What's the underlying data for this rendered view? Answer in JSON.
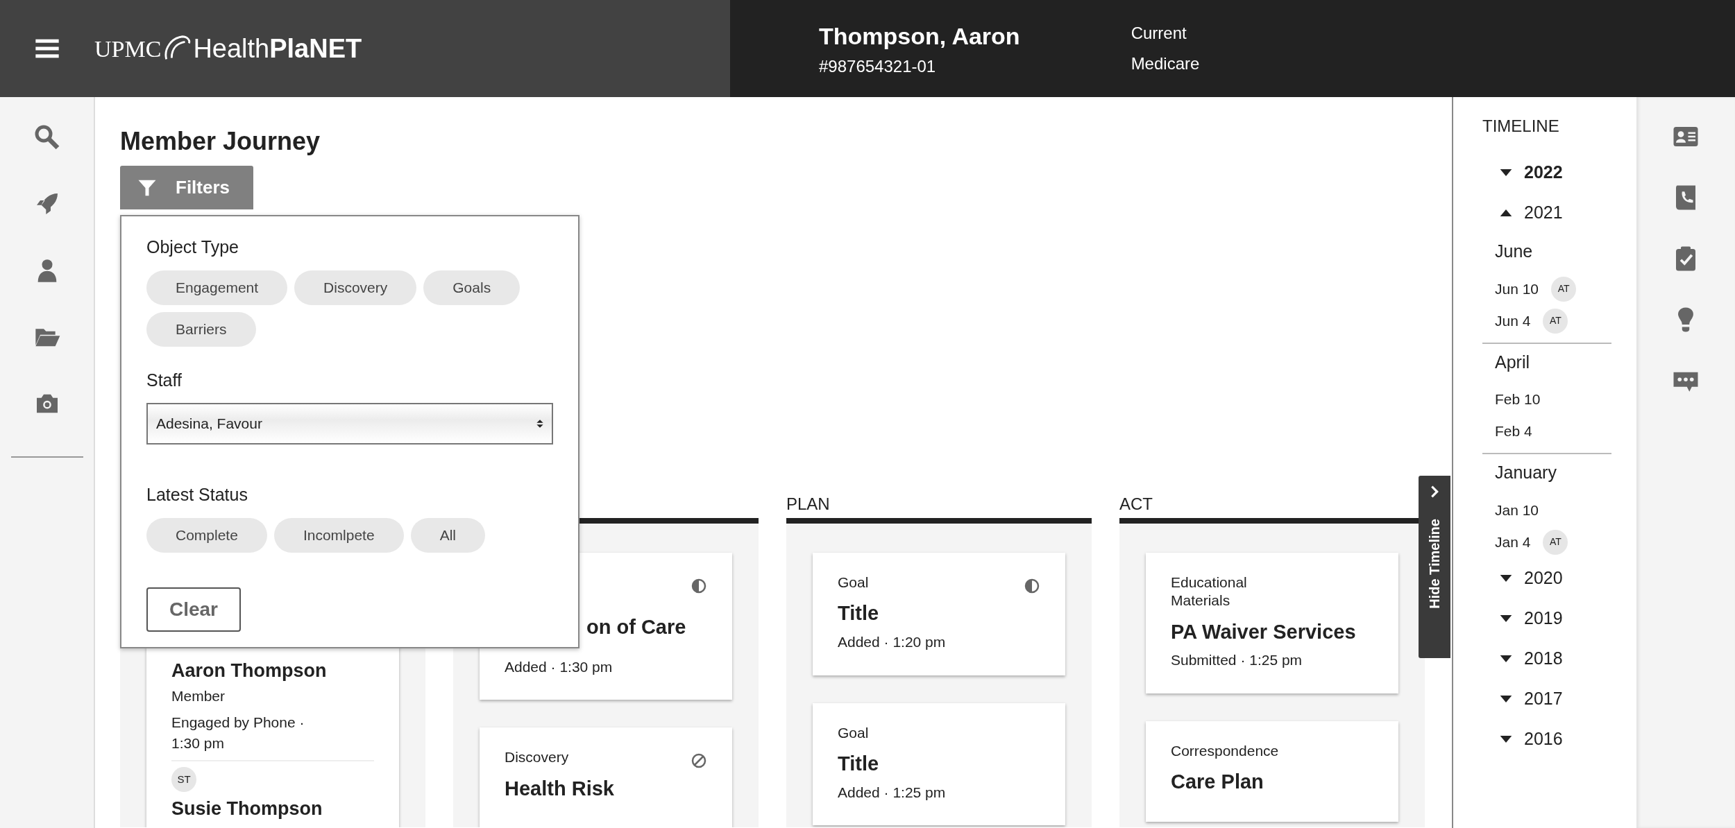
{
  "header": {
    "brand": "UPMC",
    "product": "Health**PlaNET**",
    "member_name": "Thompson, Aaron",
    "member_id": "#987654321-01",
    "coverage": [
      "Current",
      "Medicare"
    ]
  },
  "page_title": "Member Journey",
  "filters": {
    "button": "Filters",
    "sections": [
      {
        "kind": "chips",
        "label": "Object Type",
        "options": [
          "Engagement",
          "Discovery",
          "Goals",
          "Barriers"
        ]
      },
      {
        "kind": "select",
        "label": "Staff",
        "value": "Adesina, Favour"
      },
      {
        "kind": "chips",
        "label": "Latest Status",
        "options": [
          "Complete",
          "Incomlpete",
          "All"
        ]
      }
    ],
    "clear": "Clear"
  },
  "columns": [
    {
      "cards": [
        {
          "kind": "people",
          "people": [
            {
              "name": "Aaron Thompson",
              "role": "Member",
              "detail": "Engaged by Phone · 1:30 pm"
            },
            {
              "initials": "ST",
              "name": "Susie Thompson"
            }
          ]
        }
      ]
    },
    {
      "cards": [
        {
          "kind": "item",
          "title": "on of Care",
          "detail": "Added · 1:30 pm",
          "in_progress": true,
          "blocked": false
        },
        {
          "kind": "item",
          "type": "Discovery",
          "title": "Health Risk",
          "in_progress": false,
          "blocked": true
        }
      ]
    },
    {
      "heading": "PLAN",
      "cards": [
        {
          "kind": "item",
          "type": "Goal",
          "title": "Title",
          "detail": "Added · 1:20 pm",
          "in_progress": true,
          "blocked": false
        },
        {
          "kind": "item",
          "type": "Goal",
          "title": "Title",
          "detail": "Added · 1:25 pm",
          "in_progress": false,
          "blocked": false
        }
      ]
    },
    {
      "heading": "ACT",
      "cards": [
        {
          "kind": "item",
          "type": "Educational Materials",
          "title": "PA Waiver Services",
          "detail": "Submitted · 1:25 pm",
          "in_progress": false,
          "blocked": false
        },
        {
          "kind": "item",
          "type": "Correspondence",
          "title": "Care Plan",
          "in_progress": false,
          "blocked": false
        }
      ]
    }
  ],
  "timeline_toggle": "Hide Timeline",
  "timeline": {
    "title": "TIMELINE",
    "years": [
      {
        "year": "2022",
        "expanded": false,
        "current": true
      },
      {
        "year": "2021",
        "expanded": true,
        "current": false,
        "months": [
          {
            "name": "June",
            "entries": [
              {
                "date": "Jun 10",
                "initials": "AT"
              },
              {
                "date": "Jun 4",
                "initials": "AT"
              }
            ]
          },
          {
            "name": "April",
            "entries": [
              {
                "date": "Feb 10"
              },
              {
                "date": "Feb 4"
              }
            ]
          },
          {
            "name": "January",
            "entries": [
              {
                "date": "Jan 10"
              },
              {
                "date": "Jan 4",
                "initials": "AT"
              }
            ]
          }
        ]
      },
      {
        "year": "2020",
        "expanded": false,
        "current": false
      },
      {
        "year": "2019",
        "expanded": false,
        "current": false
      },
      {
        "year": "2018",
        "expanded": false,
        "current": false
      },
      {
        "year": "2017",
        "expanded": false,
        "current": false
      },
      {
        "year": "2016",
        "expanded": false,
        "current": false
      }
    ]
  }
}
